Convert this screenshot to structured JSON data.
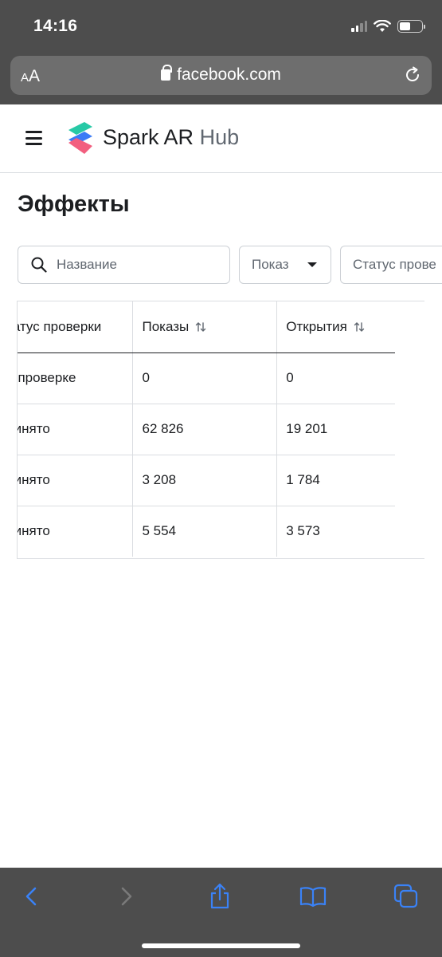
{
  "status_bar": {
    "time": "14:16"
  },
  "browser": {
    "text_size_label_small": "A",
    "text_size_label_large": "A",
    "url": "facebook.com"
  },
  "site": {
    "brand_main": "Spark AR",
    "brand_sub": "Hub",
    "logo_colors": [
      "#27c9a6",
      "#3a7bf6",
      "#f25f7f"
    ]
  },
  "page": {
    "title": "Эффекты"
  },
  "filters": {
    "search_placeholder": "Название",
    "show_label": "Показ",
    "status_label": "Статус прове"
  },
  "table": {
    "headers": [
      "Статус проверки",
      "Показы",
      "Открытия"
    ],
    "rows": [
      [
        "На проверке",
        "0",
        "0"
      ],
      [
        "Принято",
        "62 826",
        "19 201"
      ],
      [
        "Принято",
        "3 208",
        "1 784"
      ],
      [
        "Принято",
        "5 554",
        "3 573"
      ]
    ]
  },
  "colors": {
    "accent_blue": "#3a82f7",
    "chrome_gray": "#4d4d4d"
  },
  "icons": {
    "search": "search-icon",
    "sort": "sort-arrows-icon",
    "back": "chevron-left-icon",
    "forward": "chevron-right-icon",
    "share": "share-icon",
    "bookmarks": "book-icon",
    "tabs": "tabs-icon"
  }
}
